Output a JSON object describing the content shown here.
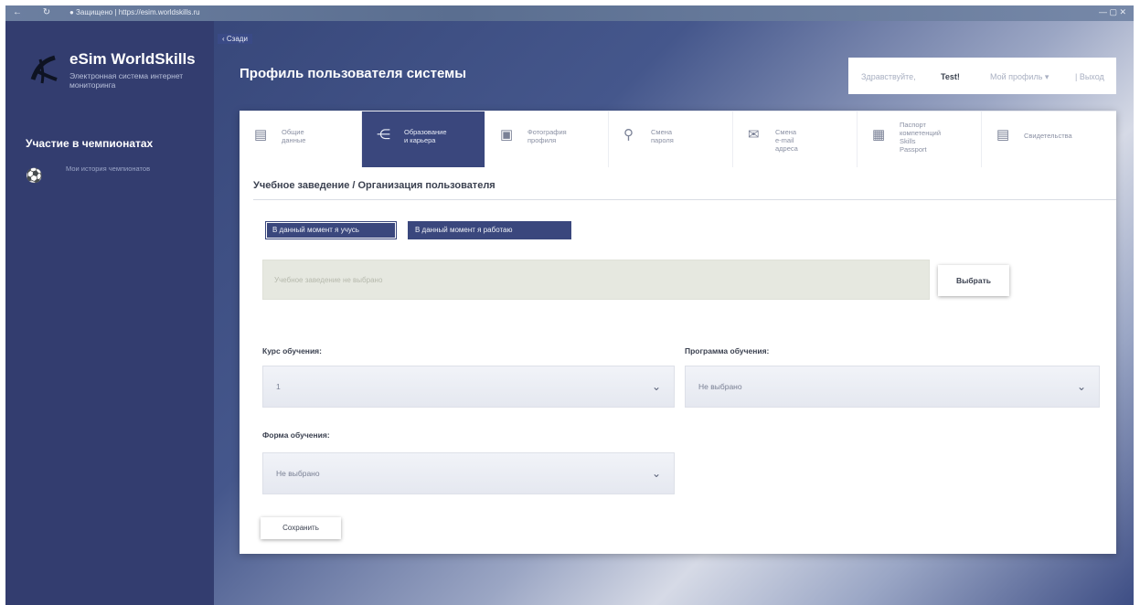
{
  "browser": {
    "nav_icons": "← ↻",
    "url": "● Защищено | https://esim.worldskills.ru"
  },
  "sidebar": {
    "logo_icon": "worldskills-logo-icon",
    "brand": "eSim WorldSkills",
    "brand_subtitle": "Электронная система интернет мониторинга",
    "section_title": "Участие в чемпионатах",
    "items": [
      {
        "icon": "soccer-ball-icon",
        "label": "Мои история чемпионатов"
      }
    ]
  },
  "header": {
    "back_label": "‹ Сзади",
    "page_title": "Профиль пользователя системы",
    "user_label": "Здравствуйте,",
    "user_name": "Test!",
    "profile_menu": "Мой профиль ▾",
    "logout": "| Выход"
  },
  "tabs": [
    {
      "icon": "document-icon",
      "label": "Общие\nданные",
      "active": false
    },
    {
      "icon": "share-icon",
      "label": "Образование\nи карьера",
      "active": true
    },
    {
      "icon": "photo-icon",
      "label": "Фотография\nпрофиля",
      "active": false
    },
    {
      "icon": "key-icon",
      "label": "Смена\nпароля",
      "active": false
    },
    {
      "icon": "mail-icon",
      "label": "Смена\ne-mail\nадреса",
      "active": false
    },
    {
      "icon": "passport-icon",
      "label": "Паспорт\nкомпетенций\nSkills\nPassport",
      "active": false
    },
    {
      "icon": "certificate-icon",
      "label": "Свидетельства",
      "active": false
    }
  ],
  "main": {
    "section_heading": "Учебное заведение / Организация пользователя",
    "toggle_studying": "В данный момент я учусь",
    "toggle_working": "В данный момент я работаю",
    "institution_placeholder": "Учебное заведение не выбрано",
    "choose_button": "Выбрать",
    "course_label": "Курс обучения:",
    "course_value": "1",
    "program_label": "Программа обучения:",
    "program_value": "Не выбрано",
    "form_label": "Форма обучения:",
    "form_value": "Не выбрано",
    "save_button": "Сохранить"
  },
  "colors": {
    "sidebar_bg": "#333d6f",
    "accent": "#3a477d",
    "field_bg": "#e6e8e0"
  }
}
